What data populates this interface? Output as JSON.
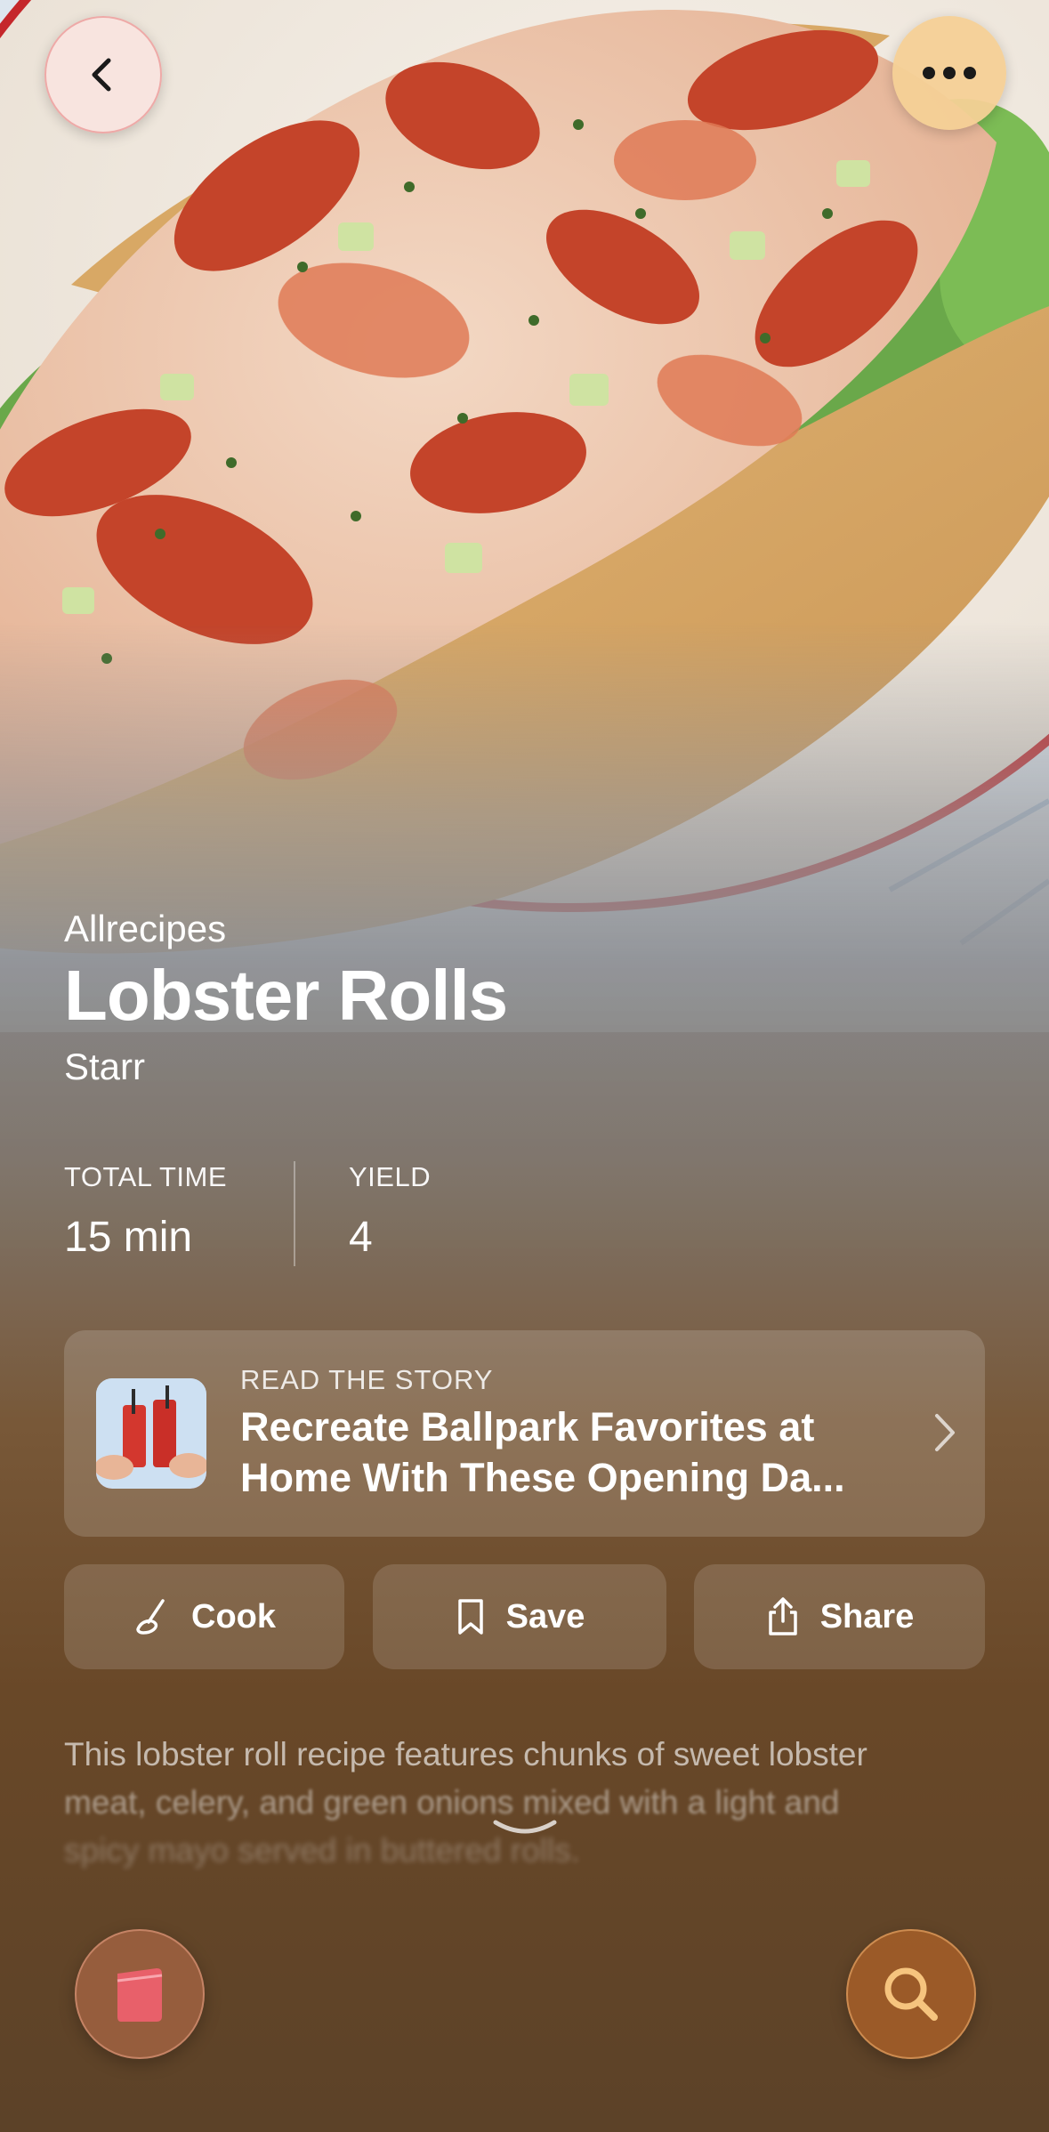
{
  "header": {
    "back_icon": "chevron-left-icon",
    "more_icon": "ellipsis-icon"
  },
  "recipe": {
    "source": "Allrecipes",
    "title": "Lobster Rolls",
    "author": "Starr"
  },
  "stats": [
    {
      "label": "TOTAL TIME",
      "value": "15 min"
    },
    {
      "label": "YIELD",
      "value": "4"
    }
  ],
  "story": {
    "kicker": "READ THE STORY",
    "headline": "Recreate Ballpark Favorites at Home With These Opening Da..."
  },
  "actions": {
    "cook": "Cook",
    "save": "Save",
    "share": "Share"
  },
  "description": {
    "line1": "This lobster roll recipe features chunks of sweet lobster",
    "line2": "meat, celery, and green onions mixed with a light and",
    "line3": "spicy mayo served in buttered rolls."
  },
  "bottom_bar": {
    "left_icon": "recipe-book-icon",
    "right_icon": "search-icon"
  },
  "colors": {
    "accent_pink": "#e8606a",
    "accent_orange": "#f0b070"
  }
}
